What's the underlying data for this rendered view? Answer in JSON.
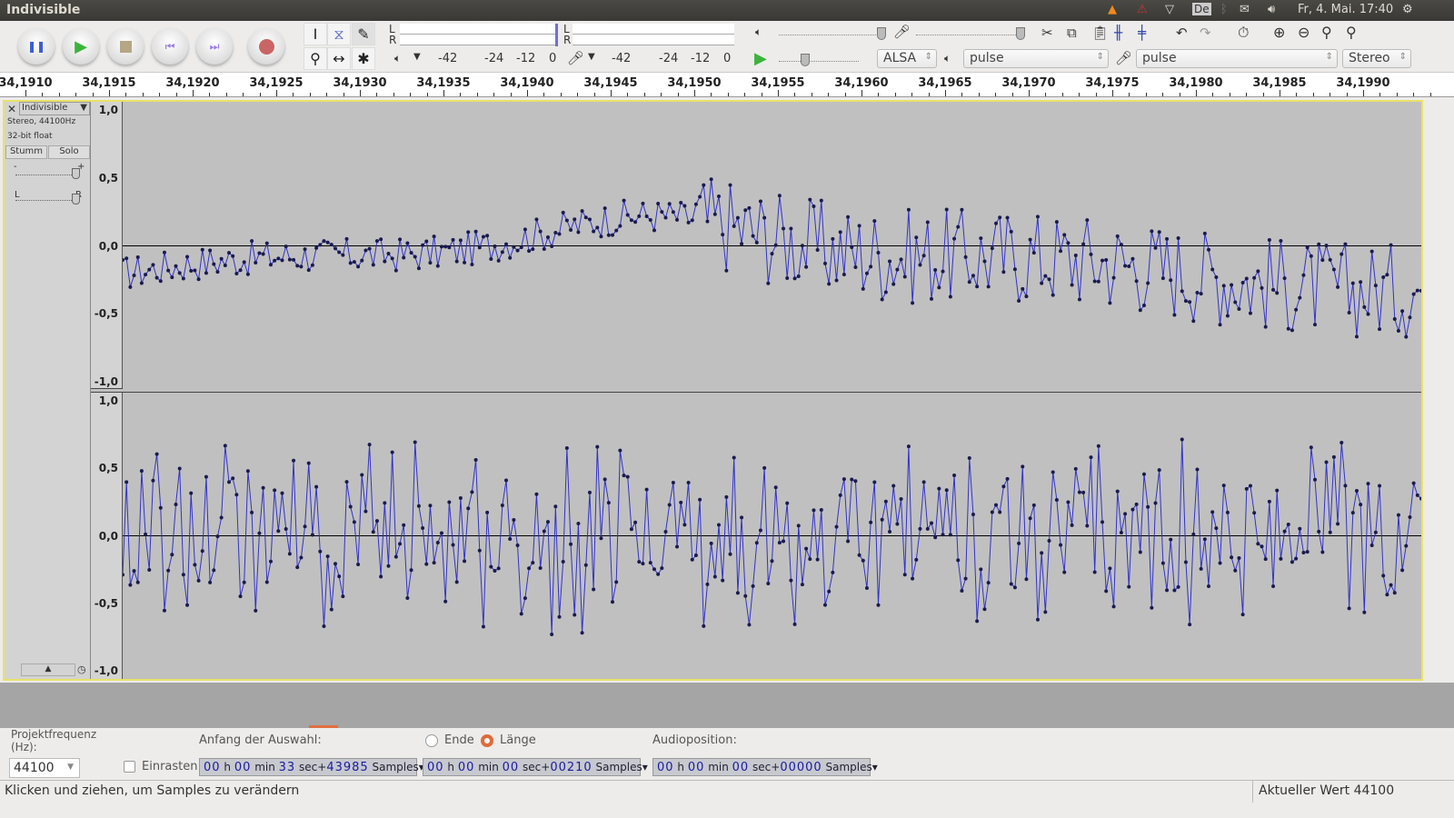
{
  "window": {
    "title": "Indivisible"
  },
  "tray": {
    "keyboard": "De",
    "datetime": "Fr, 4. Mai. 17:40",
    "icons": [
      "vlc-icon",
      "warning-icon",
      "wifi-icon",
      "bluetooth-icon",
      "mail-icon",
      "volume-icon",
      "power-icon"
    ]
  },
  "meters": {
    "left_label": "L",
    "right_label": "R",
    "play_scale": [
      "-42",
      "-24",
      "-12",
      "0"
    ],
    "rec_scale": [
      "-42",
      "-24",
      "-12",
      "0"
    ]
  },
  "device": {
    "host": "ALSA",
    "output": "pulse",
    "input": "pulse",
    "channels": "Stereo"
  },
  "ruler": {
    "labels": [
      "34,1910",
      "34,1915",
      "34,1920",
      "34,1925",
      "34,1930",
      "34,1935",
      "34,1940",
      "34,1945",
      "34,1950",
      "34,1955",
      "34,1960",
      "34,1965",
      "34,1970",
      "34,1975",
      "34,1980",
      "34,1985",
      "34,1990"
    ]
  },
  "track": {
    "name": "Indivisible",
    "info1": "Stereo, 44100Hz",
    "info2": "32-bit float",
    "mute": "Stumm",
    "solo": "Solo",
    "gain_minus": "-",
    "gain_plus": "+",
    "pan_l": "L",
    "pan_r": "R",
    "scale": [
      "1,0",
      "0,5",
      "0,0",
      "-0,5",
      "-1,0"
    ]
  },
  "colors": {
    "waveform": "#3232c8",
    "selection_border": "#e8e26a",
    "record": "#c96565",
    "play": "#3cb43c"
  },
  "selection": {
    "rate_label": "Projektfrequenz (Hz):",
    "rate": "44100",
    "snap_label": "Einrasten",
    "start_label": "Anfang der Auswahl:",
    "end_label": "Ende",
    "length_label": "Länge",
    "length_selected": true,
    "pos_label": "Audioposition:",
    "start": {
      "h": "00",
      "min": "00",
      "sec": "33",
      "samples": "43985"
    },
    "length": {
      "h": "00",
      "min": "00",
      "sec": "00",
      "samples": "00210"
    },
    "position": {
      "h": "00",
      "min": "00",
      "sec": "00",
      "samples": "00000"
    },
    "units": {
      "h": "h",
      "min": "min",
      "sec": "sec+",
      "samples": "Samples"
    }
  },
  "status": {
    "message": "Klicken und ziehen, um Samples zu verändern",
    "value": "Aktueller Wert 44100"
  }
}
